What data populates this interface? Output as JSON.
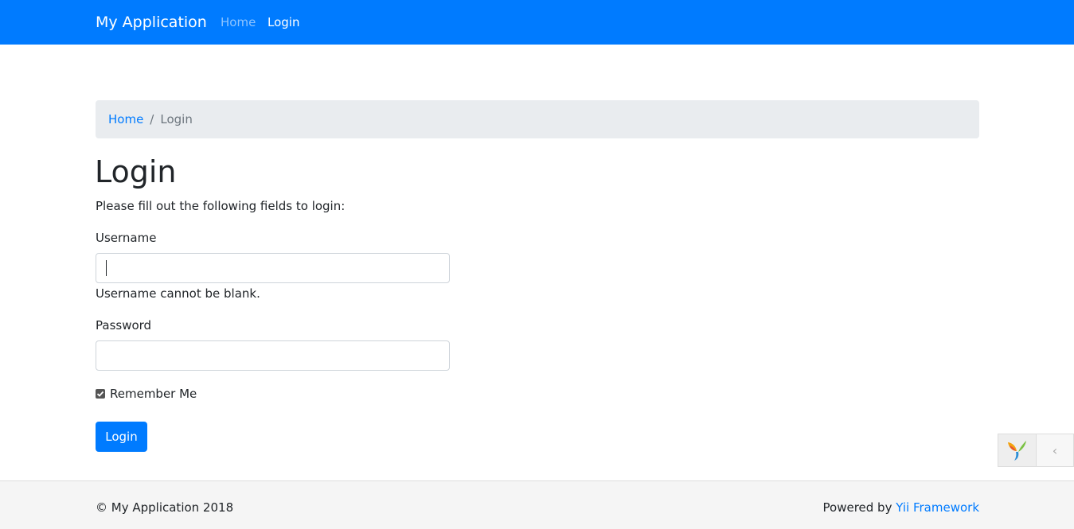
{
  "navbar": {
    "brand": "My Application",
    "items": [
      {
        "label": "Home"
      },
      {
        "label": "Login"
      }
    ]
  },
  "breadcrumb": {
    "home": "Home",
    "separator": "/",
    "current": "Login"
  },
  "page": {
    "title": "Login",
    "intro": "Please fill out the following fields to login:"
  },
  "form": {
    "username": {
      "label": "Username",
      "value": "",
      "error": "Username cannot be blank."
    },
    "password": {
      "label": "Password",
      "value": ""
    },
    "remember": {
      "label": "Remember Me",
      "checked": true
    },
    "submit_label": "Login"
  },
  "footer": {
    "copyright": "© My Application 2018",
    "powered_prefix": "Powered by ",
    "powered_link": "Yii Framework"
  },
  "debug_toolbar": {
    "toggle_glyph": "‹"
  },
  "colors": {
    "primary": "#007bff",
    "breadcrumb_bg": "#e9ecef",
    "footer_bg": "#f5f5f5"
  }
}
